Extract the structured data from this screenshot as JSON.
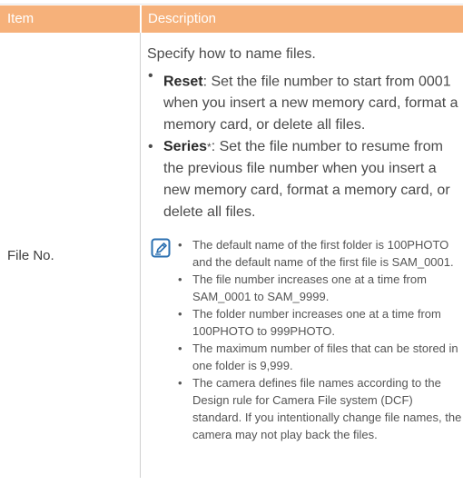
{
  "table": {
    "header": {
      "item": "Item",
      "description": "Description"
    },
    "row": {
      "item": "File No.",
      "intro": "Specify how to name files.",
      "bullets": [
        {
          "term": "Reset",
          "asterisk": "",
          "text": ": Set the file number to start from 0001 when you insert a new memory card, format a memory card, or delete all files."
        },
        {
          "term": "Series",
          "asterisk": "*",
          "text": ": Set the file number to resume from the previous file number when you insert a new memory card, format a memory card, or delete all files."
        }
      ],
      "note_icon": "note-pencil-icon",
      "notes": [
        "The default name of the first folder is 100PHOTO and the default name of the first file is SAM_0001.",
        "The file number increases one at a time from SAM_0001 to SAM_9999.",
        "The folder number increases one at a time from 100PHOTO to 999PHOTO.",
        "The maximum number of files that can be stored in one folder is 9,999.",
        "The camera defines file names according to the Design rule for Camera File system (DCF) standard. If you intentionally change file names, the camera may not play back the files."
      ]
    }
  },
  "colors": {
    "header_bg": "#f6b17a",
    "header_text": "#ffffff",
    "body_text": "#4a4a4a",
    "icon_stroke": "#2a6fb0"
  }
}
